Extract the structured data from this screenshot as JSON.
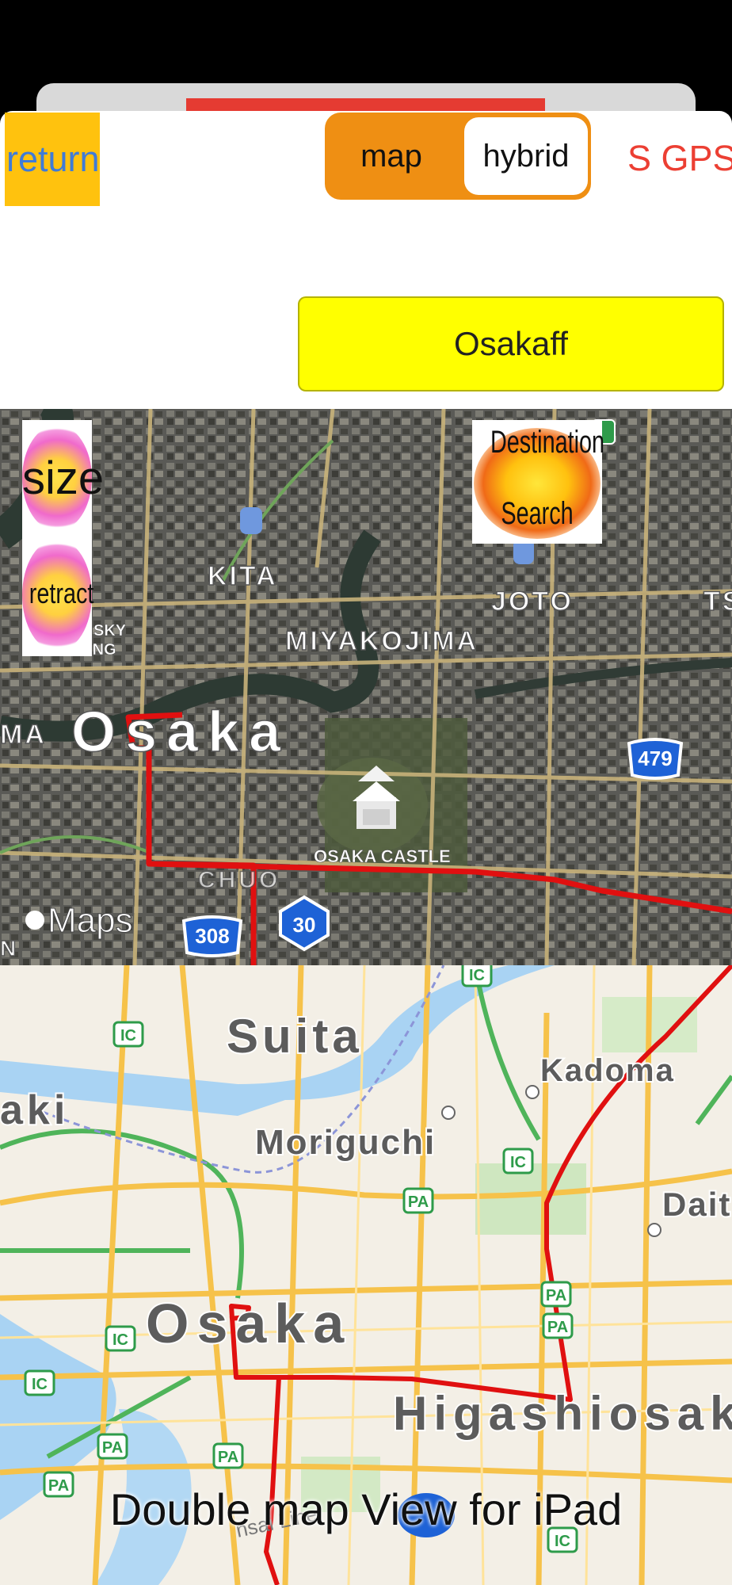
{
  "toolbar": {
    "return_label": "return",
    "map_type": {
      "options": [
        "map",
        "hybrid"
      ],
      "selected": "hybrid"
    },
    "gps_label": "S GPS"
  },
  "destination": {
    "value": "Osakaff"
  },
  "overlay_buttons": {
    "size_label": "size",
    "retract_label": "retract",
    "dest_search_line1": "Destination",
    "dest_search_line2": "Search"
  },
  "top_map": {
    "labels": [
      "KITA",
      "MIYAKOJIMA",
      "JOTO",
      "Osaka",
      "OSAKA CASTLE",
      "CHUO",
      "SKY",
      "BUILDING",
      "MA",
      "TS",
      "N"
    ],
    "route_shields": [
      "479",
      "308",
      "30"
    ],
    "attribution": "Maps"
  },
  "bottom_map": {
    "labels": [
      "Suita",
      "Kadoma",
      "aki",
      "Moriguchi",
      "Dait",
      "Osaka",
      "Higashiosak"
    ],
    "badges": [
      "IC",
      "PA"
    ],
    "line_label": "nsai Line"
  },
  "footer": {
    "title": "Double map View for iPad"
  },
  "colors": {
    "accent_orange": "#ef8f13",
    "yellow": "#ffff00",
    "return_bg": "#ffc20e",
    "gps_red": "#ec3f33",
    "route_red": "#e01010"
  }
}
